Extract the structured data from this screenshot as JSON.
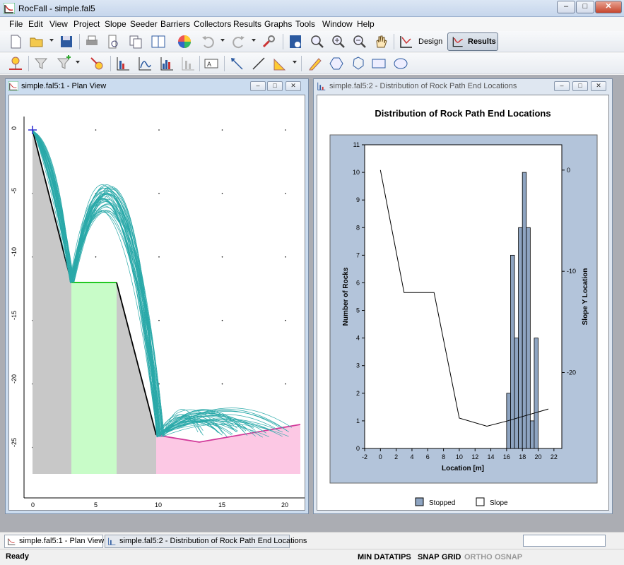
{
  "app": {
    "title": "RocFall - simple.fal5"
  },
  "window_buttons": {
    "minimize": "–",
    "maximize": "□",
    "close": "✕"
  },
  "menu": [
    "File",
    "Edit",
    "View",
    "Project",
    "Slope",
    "Seeder",
    "Barriers",
    "Collectors",
    "Results",
    "Graphs",
    "Tools",
    "Window",
    "Help"
  ],
  "toolbar1": {
    "design_label": "Design",
    "results_label": "Results"
  },
  "plan_view": {
    "title": "simple.fal5:1 - Plan View",
    "y_ticks": [
      "0",
      "-5",
      "-10",
      "-15",
      "-20",
      "-25"
    ],
    "x_ticks": [
      "0",
      "5",
      "10",
      "15",
      "20"
    ]
  },
  "dist_window": {
    "title": "simple.fal5:2 - Distribution of Rock Path End Locations"
  },
  "chart_data": {
    "type": "bar",
    "title": "Distribution of Rock Path End Locations",
    "xlabel": "Location [m]",
    "ylabel": "Number of Rocks",
    "y2label": "Slope Y Location",
    "xlim": [
      -2,
      23
    ],
    "ylim": [
      0,
      11
    ],
    "y2lim": [
      -27.5,
      2.5
    ],
    "x_ticks": [
      "-2",
      "0",
      "2",
      "4",
      "6",
      "8",
      "10",
      "12",
      "14",
      "16",
      "18",
      "20",
      "22"
    ],
    "y_ticks": [
      "0",
      "1",
      "2",
      "3",
      "4",
      "5",
      "6",
      "7",
      "8",
      "9",
      "10",
      "11"
    ],
    "y2_ticks": [
      "0",
      "-10",
      "-20"
    ],
    "bins": [
      {
        "x": 16,
        "value": 2
      },
      {
        "x": 16.5,
        "value": 7
      },
      {
        "x": 17,
        "value": 4
      },
      {
        "x": 17.5,
        "value": 8
      },
      {
        "x": 18,
        "value": 10
      },
      {
        "x": 18.5,
        "value": 8
      },
      {
        "x": 19,
        "value": 1
      },
      {
        "x": 19.5,
        "value": 4
      }
    ],
    "bin_width": 0.5,
    "slope_line": [
      {
        "x": 0,
        "y": 0
      },
      {
        "x": 3,
        "y": -12.1
      },
      {
        "x": 6.8,
        "y": -12.1
      },
      {
        "x": 10,
        "y": -24.5
      },
      {
        "x": 13.5,
        "y": -25.3
      },
      {
        "x": 16,
        "y": -24.8
      },
      {
        "x": 21.3,
        "y": -23.6
      }
    ],
    "legend": [
      {
        "name": "Stopped",
        "color": "#8ea4c1"
      },
      {
        "name": "Slope",
        "color": "#ffffff"
      }
    ]
  },
  "tabs": [
    "simple.fal5:1 - Plan View",
    "simple.fal5:2 - Distribution of Rock Path End Locations"
  ],
  "status": {
    "ready": "Ready",
    "items": [
      "MIN DATATIPS",
      "SNAP",
      "GRID",
      "ORTHO",
      "OSNAP"
    ]
  },
  "colors": {
    "accent": "#cbdcef",
    "trajectory": "#2aa9a9",
    "barrier": "#c8fcc8",
    "soil": "#fcc8e4",
    "rock": "#c8c8c8"
  }
}
